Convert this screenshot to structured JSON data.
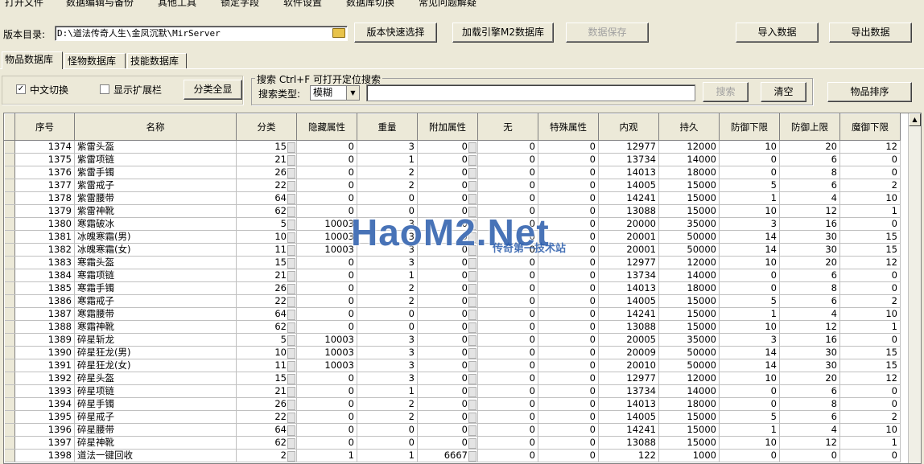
{
  "menu": [
    "打开文件",
    "数据编辑与备份",
    "其他工具",
    "锁定字段",
    "软件设置",
    "数据库切换",
    "常见问题解疑"
  ],
  "toolbar": {
    "version_dir_label": "版本目录:",
    "version_dir_value": "D:\\道法传奇人生\\金凤沉默\\MirServer",
    "quick_select": "版本快速选择",
    "load_db": "加载引擎M2数据库",
    "save_data": "数据保存",
    "import": "导入数据",
    "export": "导出数据"
  },
  "tabs": [
    "物品数据库",
    "怪物数据库",
    "技能数据库"
  ],
  "options": {
    "chinese_toggle": "中文切换",
    "chinese_checked": true,
    "show_ext": "显示扩展栏",
    "show_ext_checked": false,
    "show_all": "分类全显"
  },
  "search": {
    "title": "搜索   Ctrl+F 可打开定位搜索",
    "type_label": "搜索类型:",
    "type_value": "模糊",
    "query": "",
    "search_btn": "搜索",
    "clear_btn": "清空"
  },
  "sort_btn": "物品排序",
  "table": {
    "columns": [
      "序号",
      "名称",
      "分类",
      "隐藏属性",
      "重量",
      "附加属性",
      "无",
      "特殊属性",
      "内观",
      "持久",
      "防御下限",
      "防御上限",
      "魔御下限"
    ],
    "rows": [
      [
        "1374",
        "紫雷头盔",
        "15",
        "0",
        "3",
        "0",
        "0",
        "0",
        "12977",
        "12000",
        "10",
        "20",
        "12"
      ],
      [
        "1375",
        "紫雷项链",
        "21",
        "0",
        "1",
        "0",
        "0",
        "0",
        "13734",
        "14000",
        "0",
        "6",
        "0"
      ],
      [
        "1376",
        "紫雷手镯",
        "26",
        "0",
        "2",
        "0",
        "0",
        "0",
        "14013",
        "18000",
        "0",
        "8",
        "0"
      ],
      [
        "1377",
        "紫雷戒子",
        "22",
        "0",
        "2",
        "0",
        "0",
        "0",
        "14005",
        "15000",
        "5",
        "6",
        "2"
      ],
      [
        "1378",
        "紫雷腰带",
        "64",
        "0",
        "0",
        "0",
        "0",
        "0",
        "14241",
        "15000",
        "1",
        "4",
        "10"
      ],
      [
        "1379",
        "紫雷神靴",
        "62",
        "0",
        "0",
        "0",
        "0",
        "0",
        "13088",
        "15000",
        "10",
        "12",
        "1"
      ],
      [
        "1380",
        "寒霜破冰",
        "5",
        "10003",
        "3",
        "0",
        "0",
        "0",
        "20000",
        "35000",
        "3",
        "16",
        "0"
      ],
      [
        "1381",
        "冰魄寒霜(男)",
        "10",
        "10003",
        "3",
        "0",
        "0",
        "0",
        "20001",
        "50000",
        "14",
        "30",
        "15"
      ],
      [
        "1382",
        "冰魄寒霜(女)",
        "11",
        "10003",
        "3",
        "0",
        "0",
        "0",
        "20001",
        "50000",
        "14",
        "30",
        "15"
      ],
      [
        "1383",
        "寒霜头盔",
        "15",
        "0",
        "3",
        "0",
        "0",
        "0",
        "12977",
        "12000",
        "10",
        "20",
        "12"
      ],
      [
        "1384",
        "寒霜项链",
        "21",
        "0",
        "1",
        "0",
        "0",
        "0",
        "13734",
        "14000",
        "0",
        "6",
        "0"
      ],
      [
        "1385",
        "寒霜手镯",
        "26",
        "0",
        "2",
        "0",
        "0",
        "0",
        "14013",
        "18000",
        "0",
        "8",
        "0"
      ],
      [
        "1386",
        "寒霜戒子",
        "22",
        "0",
        "2",
        "0",
        "0",
        "0",
        "14005",
        "15000",
        "5",
        "6",
        "2"
      ],
      [
        "1387",
        "寒霜腰带",
        "64",
        "0",
        "0",
        "0",
        "0",
        "0",
        "14241",
        "15000",
        "1",
        "4",
        "10"
      ],
      [
        "1388",
        "寒霜神靴",
        "62",
        "0",
        "0",
        "0",
        "0",
        "0",
        "13088",
        "15000",
        "10",
        "12",
        "1"
      ],
      [
        "1389",
        "碎星斩龙",
        "5",
        "10003",
        "3",
        "0",
        "0",
        "0",
        "20005",
        "35000",
        "3",
        "16",
        "0"
      ],
      [
        "1390",
        "碎星狂龙(男)",
        "10",
        "10003",
        "3",
        "0",
        "0",
        "0",
        "20009",
        "50000",
        "14",
        "30",
        "15"
      ],
      [
        "1391",
        "碎星狂龙(女)",
        "11",
        "10003",
        "3",
        "0",
        "0",
        "0",
        "20010",
        "50000",
        "14",
        "30",
        "15"
      ],
      [
        "1392",
        "碎星头盔",
        "15",
        "0",
        "3",
        "0",
        "0",
        "0",
        "12977",
        "12000",
        "10",
        "20",
        "12"
      ],
      [
        "1393",
        "碎星项链",
        "21",
        "0",
        "1",
        "0",
        "0",
        "0",
        "13734",
        "14000",
        "0",
        "6",
        "0"
      ],
      [
        "1394",
        "碎星手镯",
        "26",
        "0",
        "2",
        "0",
        "0",
        "0",
        "14013",
        "18000",
        "0",
        "8",
        "0"
      ],
      [
        "1395",
        "碎星戒子",
        "22",
        "0",
        "2",
        "0",
        "0",
        "0",
        "14005",
        "15000",
        "5",
        "6",
        "2"
      ],
      [
        "1396",
        "碎星腰带",
        "64",
        "0",
        "0",
        "0",
        "0",
        "0",
        "14241",
        "15000",
        "1",
        "4",
        "10"
      ],
      [
        "1397",
        "碎星神靴",
        "62",
        "0",
        "0",
        "0",
        "0",
        "0",
        "13088",
        "15000",
        "10",
        "12",
        "1"
      ],
      [
        "1398",
        "道法一键回收",
        "2",
        "1",
        "1",
        "6667",
        "0",
        "0",
        "122",
        "1000",
        "0",
        "0",
        "0"
      ]
    ]
  },
  "watermark": {
    "main": "HaoM2.Net",
    "sub": "传奇第一技术站"
  }
}
